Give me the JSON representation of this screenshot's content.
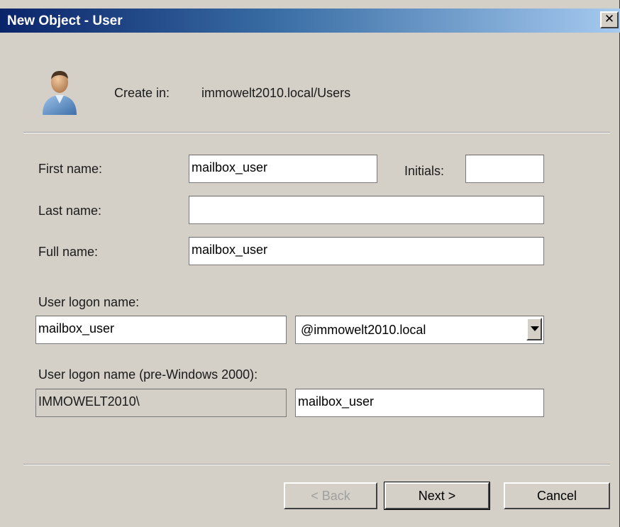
{
  "window": {
    "title": "New Object - User",
    "close_label": "✕"
  },
  "header": {
    "create_in_label": "Create in:",
    "create_in_value": "immowelt2010.local/Users"
  },
  "form": {
    "first_name_label": "First name:",
    "first_name_value": "mailbox_user",
    "initials_label": "Initials:",
    "initials_value": "",
    "last_name_label": "Last name:",
    "last_name_value": "",
    "full_name_label": "Full name:",
    "full_name_value": "mailbox_user",
    "logon_label": "User logon name:",
    "logon_value": "mailbox_user",
    "domain_selected": "@immowelt2010.local",
    "pre2000_label": "User logon name (pre-Windows 2000):",
    "pre2000_domain": "IMMOWELT2010\\",
    "pre2000_value": "mailbox_user"
  },
  "buttons": {
    "back": "< Back",
    "next": "Next >",
    "cancel": "Cancel"
  }
}
